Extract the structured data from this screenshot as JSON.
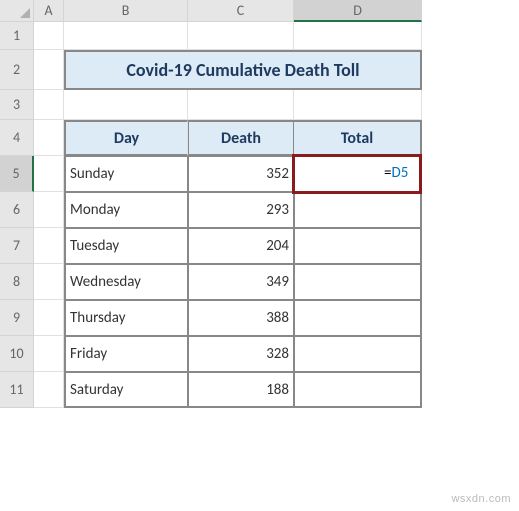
{
  "columns": [
    "A",
    "B",
    "C",
    "D"
  ],
  "rows": [
    "1",
    "2",
    "3",
    "4",
    "5",
    "6",
    "7",
    "8",
    "9",
    "10",
    "11"
  ],
  "title": "Covid-19 Cumulative Death Toll",
  "headers": {
    "day": "Day",
    "death": "Death",
    "total": "Total"
  },
  "data": [
    {
      "day": "Sunday",
      "death": "352"
    },
    {
      "day": "Monday",
      "death": "293"
    },
    {
      "day": "Tuesday",
      "death": "204"
    },
    {
      "day": "Wednesday",
      "death": "349"
    },
    {
      "day": "Thursday",
      "death": "388"
    },
    {
      "day": "Friday",
      "death": "328"
    },
    {
      "day": "Saturday",
      "death": "188"
    }
  ],
  "active_cell": {
    "address": "D5",
    "formula_prefix": "=",
    "formula_ref": "D5"
  },
  "watermark": "wsxdn.com",
  "chart_data": {
    "type": "table",
    "title": "Covid-19 Cumulative Death Toll",
    "columns": [
      "Day",
      "Death",
      "Total"
    ],
    "rows": [
      [
        "Sunday",
        352,
        null
      ],
      [
        "Monday",
        293,
        null
      ],
      [
        "Tuesday",
        204,
        null
      ],
      [
        "Wednesday",
        349,
        null
      ],
      [
        "Thursday",
        388,
        null
      ],
      [
        "Friday",
        328,
        null
      ],
      [
        "Saturday",
        188,
        null
      ]
    ]
  }
}
